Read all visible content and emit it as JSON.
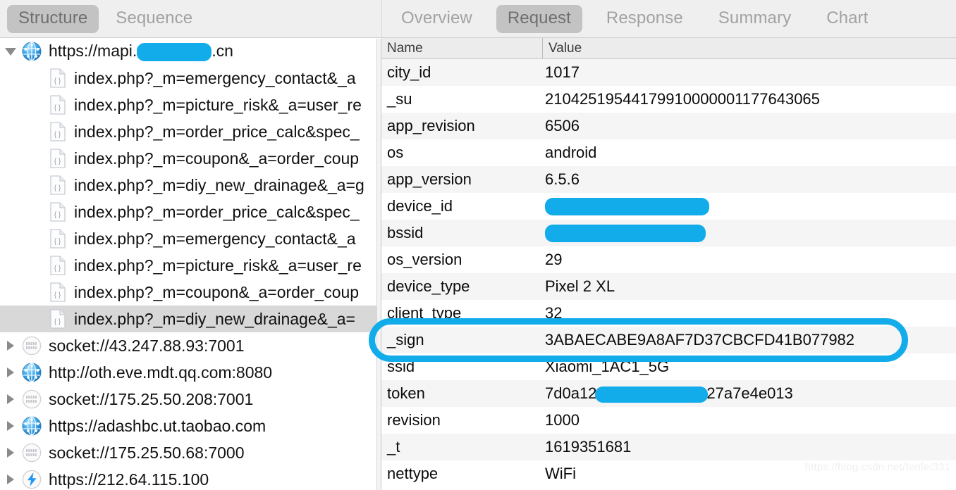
{
  "left_panel": {
    "tabs": [
      {
        "label": "Structure",
        "active": true
      },
      {
        "label": "Sequence",
        "active": false
      }
    ],
    "tree": [
      {
        "label": "https://mapi.",
        "label_suffix": ".cn",
        "icon": "globe-icon",
        "twisty": "open",
        "depth": 0,
        "censored": true,
        "censor_width": 106,
        "selected": false
      },
      {
        "label": "index.php?_m=emergency_contact&_a",
        "icon": "json-file-icon",
        "twisty": "none",
        "depth": 1,
        "selected": false
      },
      {
        "label": "index.php?_m=picture_risk&_a=user_re",
        "icon": "json-file-icon",
        "twisty": "none",
        "depth": 1,
        "selected": false
      },
      {
        "label": "index.php?_m=order_price_calc&spec_",
        "icon": "json-file-icon",
        "twisty": "none",
        "depth": 1,
        "selected": false
      },
      {
        "label": "index.php?_m=coupon&_a=order_coup",
        "icon": "json-file-icon",
        "twisty": "none",
        "depth": 1,
        "selected": false
      },
      {
        "label": "index.php?_m=diy_new_drainage&_a=g",
        "icon": "json-file-icon",
        "twisty": "none",
        "depth": 1,
        "selected": false
      },
      {
        "label": "index.php?_m=order_price_calc&spec_",
        "icon": "json-file-icon",
        "twisty": "none",
        "depth": 1,
        "selected": false
      },
      {
        "label": "index.php?_m=emergency_contact&_a",
        "icon": "json-file-icon",
        "twisty": "none",
        "depth": 1,
        "selected": false
      },
      {
        "label": "index.php?_m=picture_risk&_a=user_re",
        "icon": "json-file-icon",
        "twisty": "none",
        "depth": 1,
        "selected": false
      },
      {
        "label": "index.php?_m=coupon&_a=order_coup",
        "icon": "json-file-icon",
        "twisty": "none",
        "depth": 1,
        "selected": false
      },
      {
        "label": "index.php?_m=diy_new_drainage&_a=",
        "icon": "json-file-icon",
        "twisty": "none",
        "depth": 1,
        "selected": true
      },
      {
        "label": "socket://43.247.88.93:7001",
        "icon": "socket-icon",
        "twisty": "closed",
        "depth": 0,
        "selected": false
      },
      {
        "label": "http://oth.eve.mdt.qq.com:8080",
        "icon": "globe-icon",
        "twisty": "closed",
        "depth": 0,
        "selected": false
      },
      {
        "label": "socket://175.25.50.208:7001",
        "icon": "socket-icon",
        "twisty": "closed",
        "depth": 0,
        "selected": false
      },
      {
        "label": "https://adashbc.ut.taobao.com",
        "icon": "globe-icon",
        "twisty": "closed",
        "depth": 0,
        "selected": false
      },
      {
        "label": "socket://175.25.50.68:7000",
        "icon": "socket-icon",
        "twisty": "closed",
        "depth": 0,
        "selected": false
      },
      {
        "label": "https://212.64.115.100",
        "icon": "bolt-icon",
        "twisty": "closed",
        "depth": 0,
        "selected": false
      }
    ]
  },
  "right_panel": {
    "tabs": [
      {
        "label": "Overview",
        "active": false
      },
      {
        "label": "Request",
        "active": true
      },
      {
        "label": "Response",
        "active": false
      },
      {
        "label": "Summary",
        "active": false
      },
      {
        "label": "Chart",
        "active": false
      }
    ],
    "columns": {
      "name": "Name",
      "value": "Value"
    },
    "rows": [
      {
        "name": "city_id",
        "value": "1017"
      },
      {
        "name": "_su",
        "value": "21042519544179910000001177643065"
      },
      {
        "name": "app_revision",
        "value": "6506"
      },
      {
        "name": "os",
        "value": "android"
      },
      {
        "name": "app_version",
        "value": "6.5.6"
      },
      {
        "name": "device_id",
        "value": "",
        "censored": true,
        "censor_width": 233
      },
      {
        "name": "bssid",
        "value": "",
        "censored": true,
        "censor_width": 228
      },
      {
        "name": "os_version",
        "value": "29"
      },
      {
        "name": "device_type",
        "value": "Pixel 2 XL"
      },
      {
        "name": "client_type",
        "value": "32"
      },
      {
        "name": "_sign",
        "value": "3ABAECABE9A8AF7D37CBCFD41B077982",
        "annotated": true
      },
      {
        "name": "ssid",
        "value": "Xiaomi_1AC1_5G"
      },
      {
        "name": "token",
        "value_prefix": "7d0a12",
        "value_suffix": "27a7e4e013",
        "value": "7d0a12",
        "censored_inline": true,
        "censor_width": 160
      },
      {
        "name": "revision",
        "value": "1000"
      },
      {
        "name": "_t",
        "value": "1619351681"
      },
      {
        "name": "nettype",
        "value": "WiFi"
      }
    ]
  },
  "watermark": {
    "text": "https://blog.csdn.net/fenfei331"
  },
  "colors": {
    "highlight": "#12ACEB",
    "tab_active_bg": "#c3c3c3",
    "tab_text": "#a2a2a2",
    "selection_bg": "#d8d8d8",
    "row_alt_bg": "#f5f5f5"
  }
}
